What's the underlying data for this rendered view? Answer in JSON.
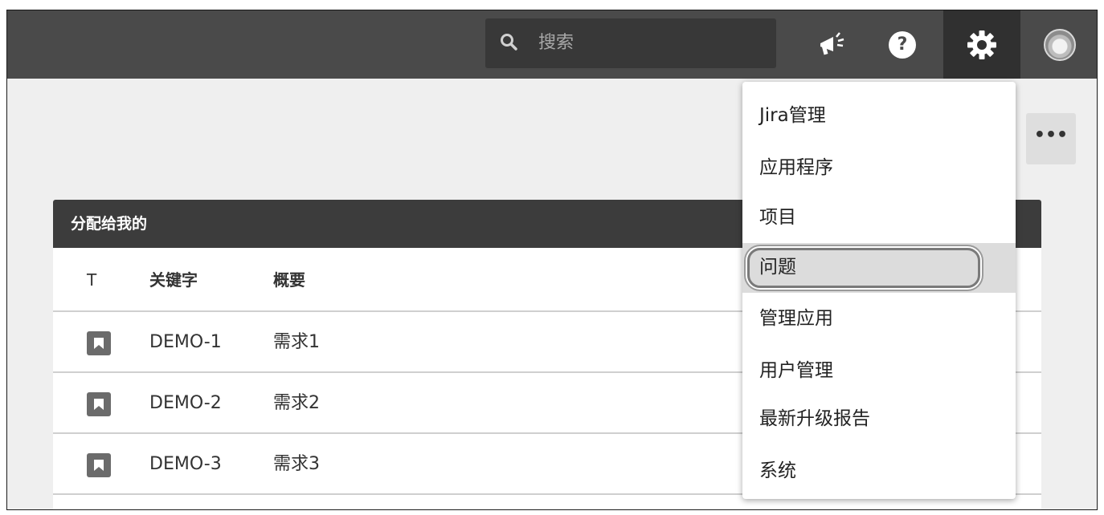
{
  "header": {
    "search": {
      "placeholder": "搜索"
    },
    "icons": [
      "megaphone-icon",
      "help-icon",
      "gear-icon",
      "avatar"
    ],
    "help_glyph": "?"
  },
  "toolbar": {
    "more_label": "•••"
  },
  "dashboard": {
    "gadget_title": "分配给我的",
    "columns": [
      "T",
      "关键字",
      "概要"
    ],
    "rows": [
      {
        "type_icon": "story-icon",
        "key": "DEMO-1",
        "summary": "需求1"
      },
      {
        "type_icon": "story-icon",
        "key": "DEMO-2",
        "summary": "需求2"
      },
      {
        "type_icon": "story-icon",
        "key": "DEMO-3",
        "summary": "需求3"
      }
    ]
  },
  "admin_menu": {
    "items": [
      {
        "label": "Jira管理"
      },
      {
        "label": "应用程序"
      },
      {
        "label": "项目"
      },
      {
        "label": "问题",
        "highlighted": true
      },
      {
        "label": "管理应用"
      },
      {
        "label": "用户管理"
      },
      {
        "label": "最新升级报告"
      },
      {
        "label": "系统"
      }
    ]
  },
  "colors": {
    "topbar": "#4a4a4a",
    "header": "#3c3c3c",
    "highlight": "#dcdcdc"
  }
}
